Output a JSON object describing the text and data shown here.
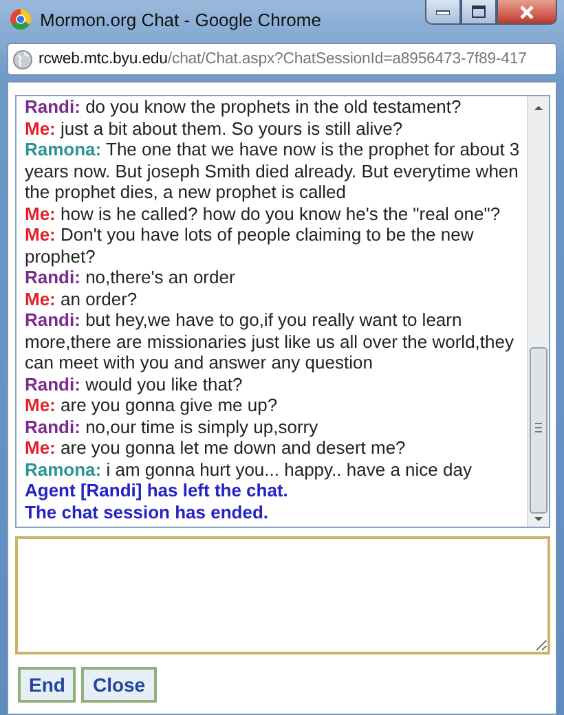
{
  "window": {
    "title": "Mormon.org Chat - Google Chrome"
  },
  "address_bar": {
    "host": "rcweb.mtc.byu.edu",
    "path": "/chat/Chat.aspx?ChatSessionId=a8956473-7f89-417"
  },
  "messages": [
    {
      "kind": "chat",
      "speaker": "Randi:",
      "color": "#7b2b8c",
      "text": "do you know the prophets in the old testament?"
    },
    {
      "kind": "chat",
      "speaker": "Me:",
      "color": "#e3202a",
      "text": "just a bit about them. So yours is still alive?"
    },
    {
      "kind": "chat",
      "speaker": "Ramona:",
      "color": "#2b9393",
      "text": "The one that we have now is the prophet for about 3 years now. But joseph Smith died already. But everytime when the prophet dies, a new prophet is called"
    },
    {
      "kind": "chat",
      "speaker": "Me:",
      "color": "#e3202a",
      "text": "how is he called? how do you know he's the \"real one\"?"
    },
    {
      "kind": "chat",
      "speaker": "Me:",
      "color": "#e3202a",
      "text": "Don't you have lots of people claiming to be the new prophet?"
    },
    {
      "kind": "chat",
      "speaker": "Randi:",
      "color": "#7b2b8c",
      "text": "no,there's an order"
    },
    {
      "kind": "chat",
      "speaker": "Me:",
      "color": "#e3202a",
      "text": "an order?"
    },
    {
      "kind": "chat",
      "speaker": "Randi:",
      "color": "#7b2b8c",
      "text": "but hey,we have to go,if you really want to learn more,there are missionaries just like us all over the world,they can meet with you and answer any question"
    },
    {
      "kind": "chat",
      "speaker": "Randi:",
      "color": "#7b2b8c",
      "text": "would you like that?"
    },
    {
      "kind": "chat",
      "speaker": "Me:",
      "color": "#e3202a",
      "text": "are you gonna give me up?"
    },
    {
      "kind": "chat",
      "speaker": "Randi:",
      "color": "#7b2b8c",
      "text": "no,our time is simply up,sorry"
    },
    {
      "kind": "chat",
      "speaker": "Me:",
      "color": "#e3202a",
      "text": "are you gonna let me down and desert me?"
    },
    {
      "kind": "chat",
      "speaker": "Ramona:",
      "color": "#2b9393",
      "text": "i am gonna hurt you... happy.. have a nice day"
    },
    {
      "kind": "system",
      "text": "Agent [Randi] has left the chat."
    },
    {
      "kind": "system",
      "text": "The chat session has ended."
    }
  ],
  "buttons": [
    "End",
    "Close"
  ]
}
